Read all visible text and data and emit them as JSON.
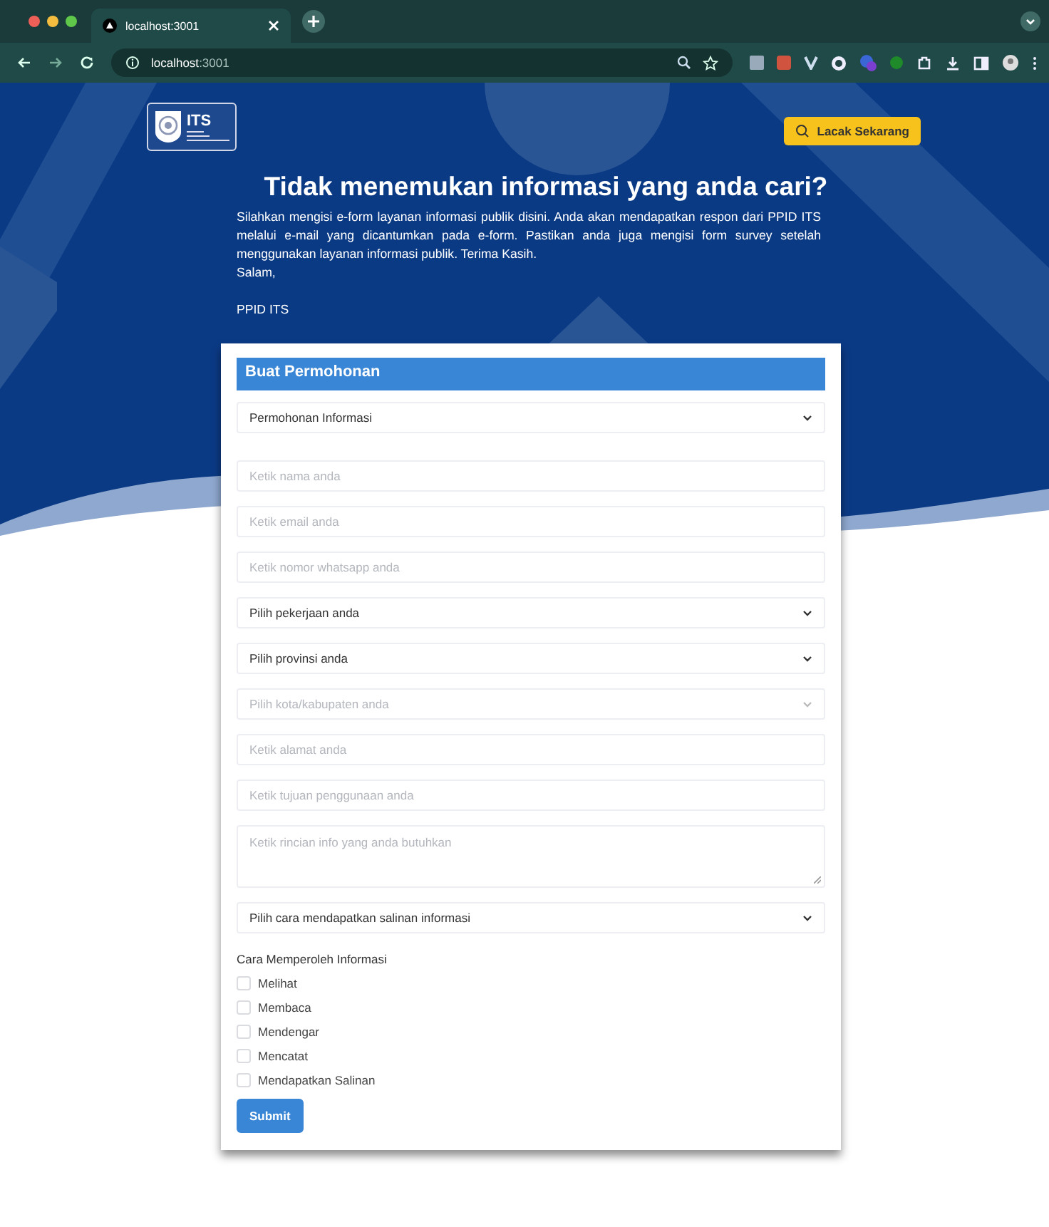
{
  "browser": {
    "tab_title": "localhost:3001",
    "url_host": "localhost",
    "url_port": ":3001"
  },
  "header": {
    "logo_text": "ITS",
    "track_button": "Lacak Sekarang"
  },
  "hero": {
    "title": "Tidak menemukan informasi yang anda cari?",
    "paragraph": "Silahkan mengisi e-form layanan informasi publik disini. Anda akan mendapatkan respon dari PPID ITS melalui e-mail yang dicantumkan pada e-form. Pastikan anda juga mengisi form survey setelah menggunakan layanan informasi publik. Terima Kasih.",
    "greeting": "Salam,",
    "signature": "PPID ITS"
  },
  "form": {
    "title": "Buat Permohonan",
    "fields": [
      {
        "kind": "select",
        "value": "Permohonan Informasi",
        "disabled": false
      },
      {
        "kind": "input",
        "placeholder": "Ketik nama anda"
      },
      {
        "kind": "input",
        "placeholder": "Ketik email anda"
      },
      {
        "kind": "input",
        "placeholder": "Ketik nomor whatsapp anda"
      },
      {
        "kind": "select",
        "value": "Pilih pekerjaan anda",
        "disabled": false
      },
      {
        "kind": "select",
        "value": "Pilih provinsi anda",
        "disabled": false
      },
      {
        "kind": "select",
        "placeholder": "Pilih kota/kabupaten anda",
        "disabled": true
      },
      {
        "kind": "input",
        "placeholder": "Ketik alamat anda"
      },
      {
        "kind": "input",
        "placeholder": "Ketik tujuan penggunaan anda"
      },
      {
        "kind": "textarea",
        "placeholder": "Ketik rincian info yang anda butuhkan"
      },
      {
        "kind": "select",
        "value": "Pilih cara mendapatkan salinan informasi",
        "disabled": false
      }
    ],
    "checkbox_group": {
      "label": "Cara Memperoleh Informasi",
      "options": [
        {
          "label": "Melihat",
          "checked": false
        },
        {
          "label": "Membaca",
          "checked": false
        },
        {
          "label": "Mendengar",
          "checked": false
        },
        {
          "label": "Mencatat",
          "checked": false
        },
        {
          "label": "Mendapatkan Salinan",
          "checked": false
        }
      ]
    },
    "submit": "Submit"
  }
}
